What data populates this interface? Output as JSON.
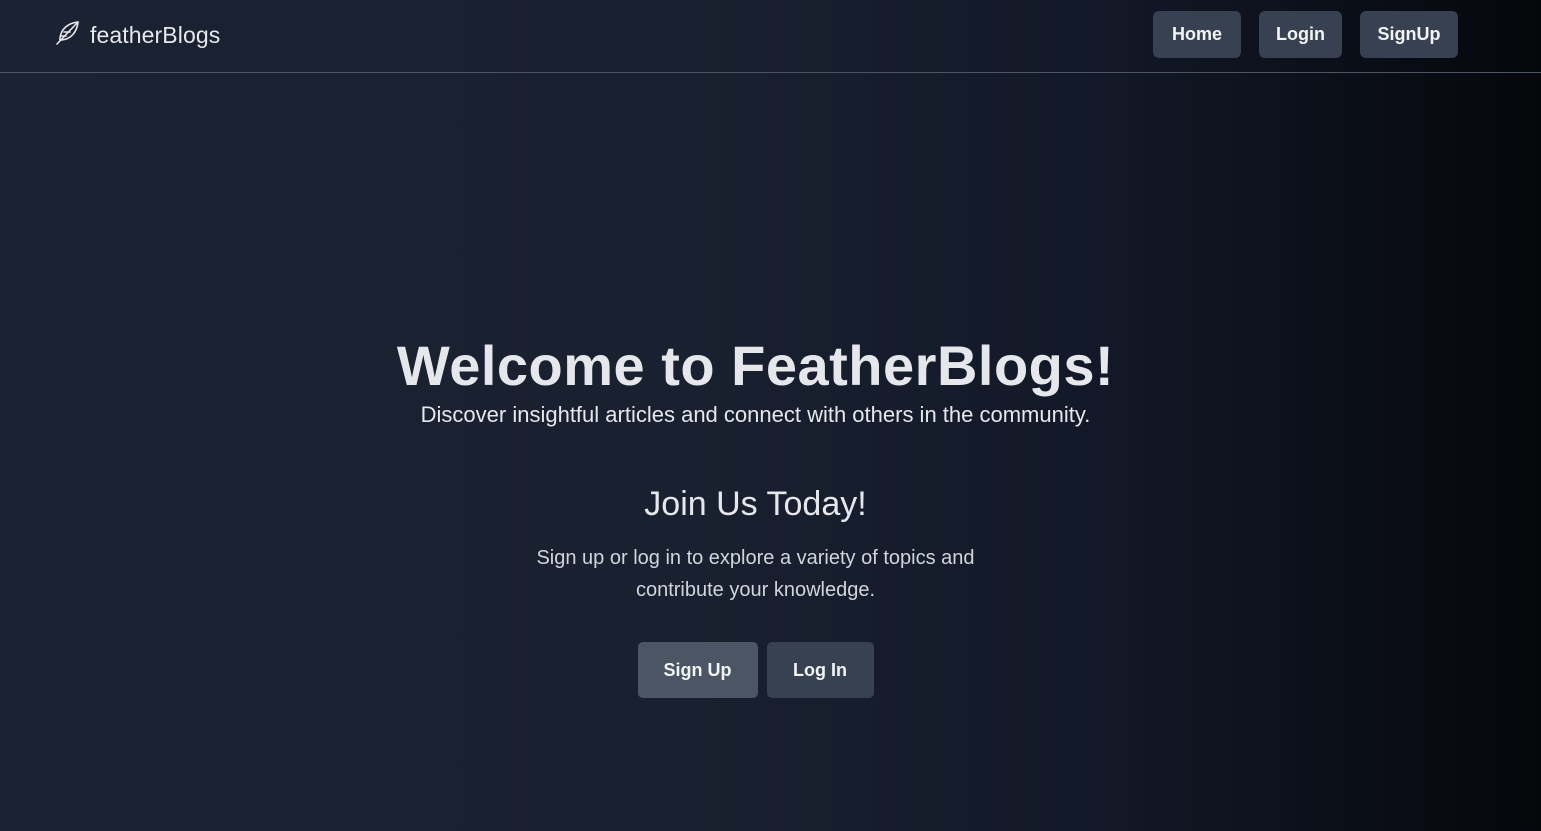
{
  "navbar": {
    "brand": {
      "icon": "feather-icon",
      "name": "featherBlogs"
    },
    "links": [
      {
        "label": "Home"
      },
      {
        "label": "Login"
      },
      {
        "label": "SignUp"
      }
    ]
  },
  "hero": {
    "title": "Welcome to FeatherBlogs!",
    "subtitle": "Discover insightful articles and connect with others in the community."
  },
  "join": {
    "title": "Join Us Today!",
    "text": "Sign up or log in to explore a variety of topics and contribute your knowledge.",
    "signup_label": "Sign Up",
    "login_label": "Log In"
  },
  "colors": {
    "background_start": "#1b2233",
    "background_end": "#05070b",
    "nav_button": "#374151",
    "primary_button": "#4b5563",
    "text": "#e5e7eb"
  }
}
